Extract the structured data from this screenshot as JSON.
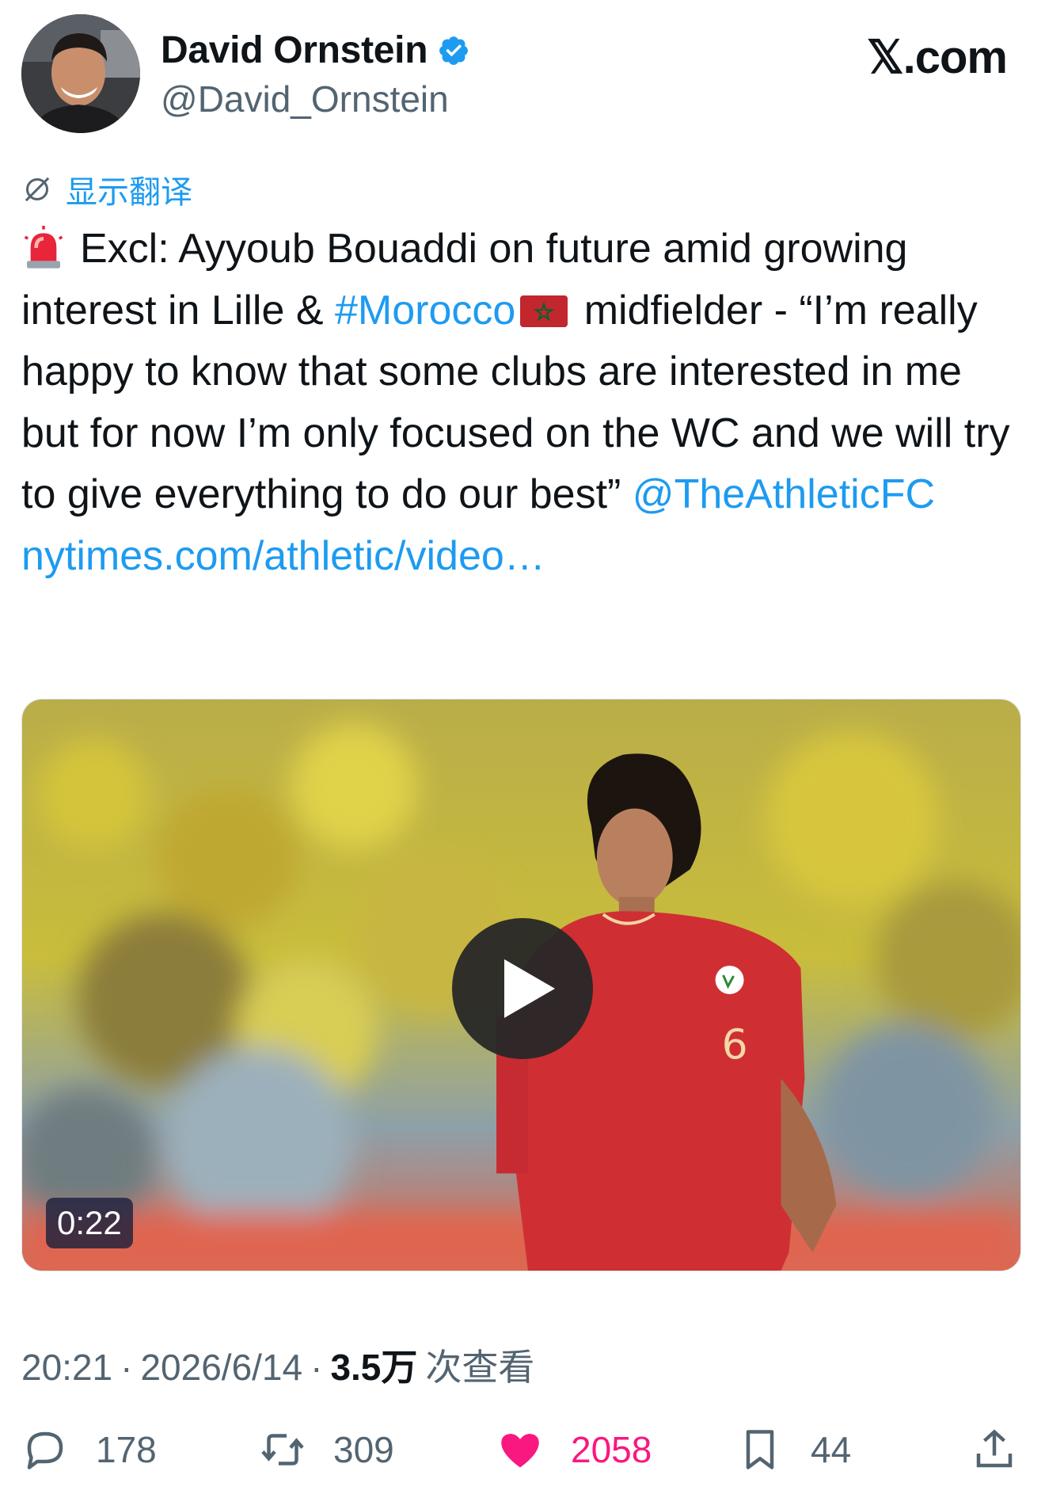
{
  "author": {
    "name": "David Ornstein",
    "handle": "@David_Ornstein",
    "verified": true,
    "verified_color": "#1d9bf0"
  },
  "watermark": "𝕏.com",
  "translate": {
    "icon": "globe-slash-icon",
    "label": "显示翻译"
  },
  "tweet": {
    "segments": {
      "emoji": "rotating-light-emoji",
      "t1": "Excl: Ayyoub Bouaddi on future amid growing interest in Lille & ",
      "hashtag": "#Morocco",
      "flag": "morocco-flag-emoji",
      "t2": " midfielder - “I’m really happy to know that some clubs are interested in me but for now I’m only focused on the WC and we will try to give everything to do our best” ",
      "mention": "@TheAthleticFC",
      "t3": " ",
      "url": "nytimes.com/athletic/video…"
    }
  },
  "media": {
    "type": "video",
    "duration": "0:22",
    "play_icon": "play-icon"
  },
  "meta": {
    "time": "20:21",
    "separator": "·",
    "date": "2026/6/14",
    "views_count": "3.5万",
    "views_label": "次查看"
  },
  "actions": {
    "reply": {
      "icon": "reply-icon",
      "count": "178"
    },
    "retweet": {
      "icon": "retweet-icon",
      "count": "309"
    },
    "like": {
      "icon": "heart-icon",
      "count": "2058",
      "liked": true,
      "color": "#f91880"
    },
    "bookmark": {
      "icon": "bookmark-icon",
      "count": "44"
    },
    "share": {
      "icon": "share-icon"
    }
  },
  "colors": {
    "link": "#1d9bf0",
    "secondary_text": "#536471",
    "primary_text": "#0f1419"
  }
}
